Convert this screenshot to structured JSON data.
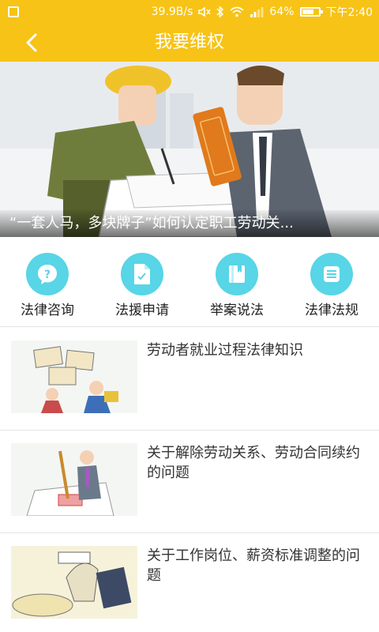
{
  "status_bar": {
    "speed": "39.9B/s",
    "battery_percent": "64%",
    "time": "下午2:40"
  },
  "nav": {
    "title": "我要维权",
    "back_icon": "chevron-left-icon"
  },
  "banner": {
    "caption": "“一套人马，多块牌子”如何认定职工劳动关..."
  },
  "quick_menu": [
    {
      "label": "法律咨询",
      "icon": "question-bubble-icon"
    },
    {
      "label": "法援申请",
      "icon": "document-icon"
    },
    {
      "label": "举案说法",
      "icon": "book-icon"
    },
    {
      "label": "法律法规",
      "icon": "list-icon"
    }
  ],
  "news": [
    {
      "title": "劳动者就业过程法律知识"
    },
    {
      "title": "关于解除劳动关系、劳动合同续约的问题"
    },
    {
      "title": "关于工作岗位、薪资标准调整的问题"
    }
  ],
  "colors": {
    "primary": "#f7c316",
    "icon_bg": "#58d5e6"
  }
}
